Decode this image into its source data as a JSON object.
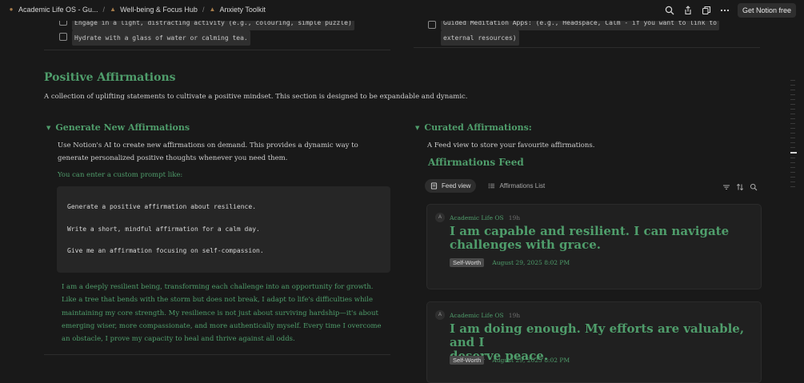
{
  "breadcrumbs": [
    {
      "label": "Academic Life OS - Gu..."
    },
    {
      "label": "Well-being & Focus Hub"
    },
    {
      "label": "Anxiety Toolkit"
    }
  ],
  "topbar": {
    "cta": "Get Notion free"
  },
  "checklist_left": [
    {
      "text": "Engage in a light, distracting activity (e.g., colouring, simple puzzle)"
    },
    {
      "text": "Hydrate with a glass of water or calming tea."
    }
  ],
  "checklist_right": {
    "line1": "Guided Meditation Apps: (e.g., Headspace, Calm - if you want to link to",
    "line2": "external resources)"
  },
  "section": {
    "title": "Positive Affirmations",
    "description": "A collection of uplifting statements to cultivate a positive mindset. This section is designed to be expandable and dynamic."
  },
  "generate": {
    "heading": "Generate New Affirmations",
    "para_line1": "Use Notion's AI to create new affirmations on demand. This provides a dynamic way to",
    "para_line2": "generate personalized positive thoughts whenever you need them.",
    "prompt_label": "You can enter a custom prompt like:",
    "code": [
      "Generate a positive affirmation about resilience.",
      "Write a short, mindful affirmation for a calm day.",
      "Give me an affirmation focusing on self-compassion."
    ],
    "ai_lines": [
      "I am a deeply resilient being, transforming each challenge into an opportunity for growth.",
      "Like a tree that bends with the storm but does not break, I adapt to life's difficulties while",
      "maintaining my core strength. My resilience is not just about surviving hardship—it's about",
      "emerging wiser, more compassionate, and more authentically myself. Every time I overcome",
      "an obstacle, I prove my capacity to heal and thrive against all odds."
    ]
  },
  "curated": {
    "heading": "Curated Affirmations:",
    "description": "A Feed view to store your favourite affirmations.",
    "feed_title": "Affirmations Feed",
    "tabs": [
      {
        "label": "Feed view"
      },
      {
        "label": "Affirmations List"
      }
    ]
  },
  "cards": [
    {
      "avatar": "A",
      "author": "Academic Life OS",
      "time": "19h",
      "title_line1": "I am capable and resilient. I can navigate",
      "title_line2": "challenges with grace.",
      "tag": "Self-Worth",
      "date": "August 29, 2025 8:02 PM"
    },
    {
      "avatar": "A",
      "author": "Academic Life OS",
      "time": "19h",
      "title_line1": "I am doing enough. My efforts are valuable, and I",
      "title_line2": "deserve peace.",
      "tag": "Self-Worth",
      "date": "August 29, 2025 8:02 PM"
    }
  ],
  "icons": {
    "search": "search-icon",
    "share": "share-icon",
    "duplicate": "duplicate-icon",
    "more": "more-icon",
    "filter": "filter-icon",
    "sort": "sort-icon",
    "feed_search": "search-icon"
  },
  "colors": {
    "accent": "#4f9d6b",
    "background": "#191919"
  }
}
